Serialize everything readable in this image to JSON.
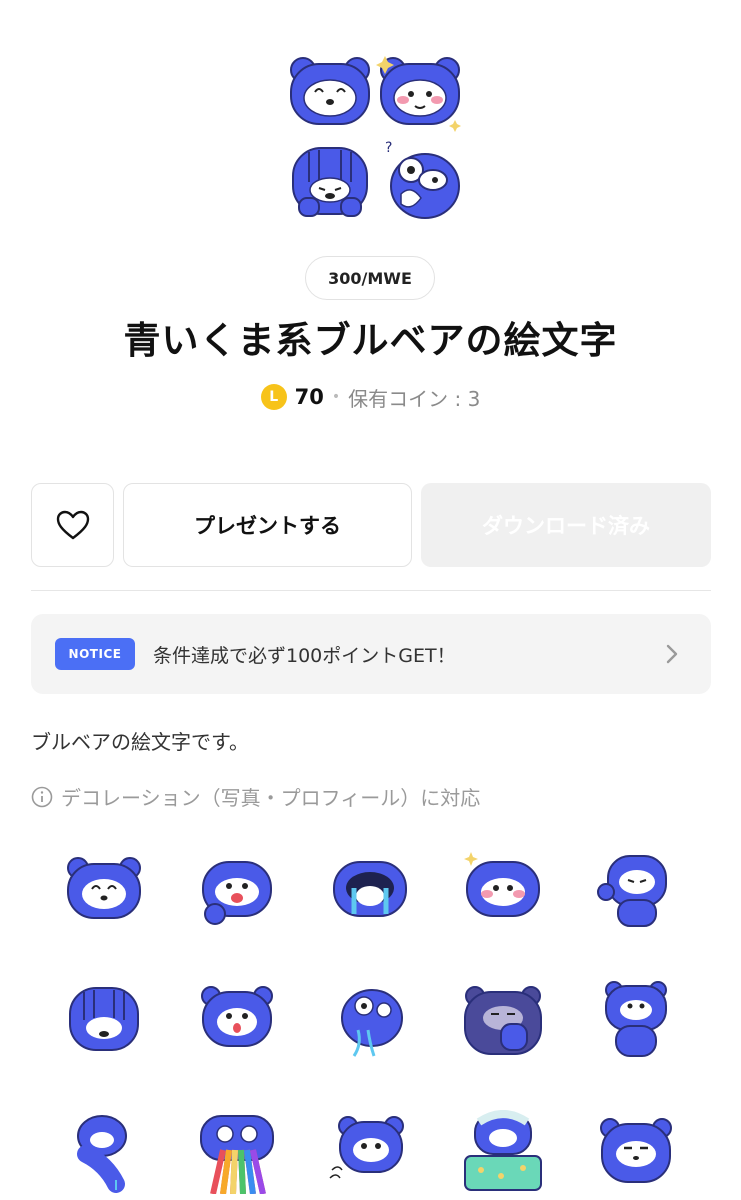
{
  "product": {
    "creator_badge": "300/MWE",
    "title": "青いくま系ブルベアの絵文字",
    "coin_letter": "L",
    "price": "70",
    "price_separator": "•",
    "owned_coins": "保有コイン : 3",
    "description": "ブルベアの絵文字です。",
    "decoration_note": "デコレーション（写真・プロフィール）に対応"
  },
  "actions": {
    "favorite_icon": "heart-icon",
    "present_label": "プレゼントする",
    "download_label": "ダウンロード済み"
  },
  "notice": {
    "tag": "NOTICE",
    "text": "条件達成で必ず100ポイントGET！",
    "icon": "chevron-right-icon"
  },
  "colors": {
    "bear_blue": "#4a5ae8",
    "bear_purple": "#4a4a9a",
    "notice_tag": "#4b6ff5",
    "coin": "#f7c31a",
    "download_disabled_bg": "#f0f0f0"
  },
  "hero_emojis": [
    "bear-smile",
    "bear-sparkle-blush",
    "bear-hiding-face",
    "bear-confused-big-eyes"
  ],
  "emoji_grid": [
    "bear-smile",
    "bear-tongue-out",
    "bear-crying",
    "bear-sparkle-blush",
    "bear-wink-peace",
    "bear-hiding-face",
    "bear-shocked",
    "bear-drooling",
    "bear-purple-gloomy",
    "bear-standing",
    "bear-dancing",
    "bear-rainbow-vomit",
    "bear-dizzy",
    "bear-sleeping-bed",
    "bear-annoyed"
  ]
}
